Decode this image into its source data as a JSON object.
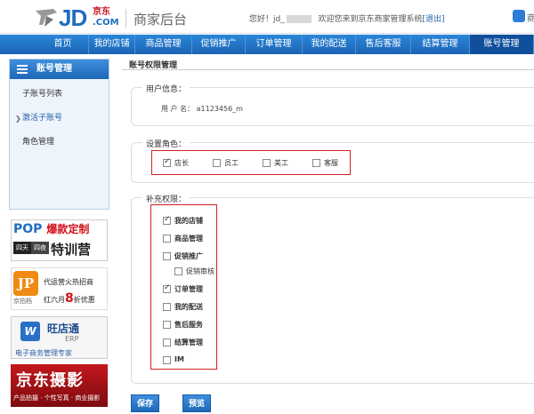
{
  "header": {
    "brand_cn": "京东",
    "brand_jd": "JD",
    "brand_com": ".COM",
    "title": "商家后台",
    "greeting": "您好！jd_",
    "welcome_text": "欢迎您来到京东商家管理系统",
    "logout_label": "[退出]",
    "message_label": "商"
  },
  "nav": {
    "items": [
      "首页",
      "我的店铺",
      "商品管理",
      "促销推广",
      "订单管理",
      "我的配送",
      "售后客服",
      "结算管理",
      "账号管理"
    ],
    "active": "账号管理"
  },
  "sidebar": {
    "title": "账号管理",
    "items": [
      {
        "label": "子账号列表",
        "active": false
      },
      {
        "label": "激活子账号",
        "active": true
      },
      {
        "label": "角色管理",
        "active": false
      }
    ]
  },
  "banners": {
    "b1_pop": "POP",
    "b1_red": "爆款定制",
    "b1_sq1": "四天",
    "b1_sq2": "四夜",
    "b1_big": "特训营",
    "b2_logo": "JP",
    "b2_sub": "京拍档",
    "b2_l1": "代运营火热招商",
    "b2_l2a": "红六月",
    "b2_l2b": "8",
    "b2_l2c": "折优惠",
    "b3_icon": "W",
    "b3_t1": "旺店通",
    "b3_t2": "ERP",
    "b3_t3": "电子商务管理专家",
    "b4_t1": "京东摄影",
    "b4_t2": "产品拍摄 · 个性写真 · 商业摄影"
  },
  "main": {
    "page_title": "账号权限管理",
    "user_info": {
      "legend": "用户信息：",
      "username_label": "用 户 名：",
      "username_value": "a1123456_m"
    },
    "roles": {
      "legend": "设置角色：",
      "items": [
        {
          "label": "店长",
          "checked": true
        },
        {
          "label": "员工",
          "checked": false
        },
        {
          "label": "美工",
          "checked": false
        },
        {
          "label": "客服",
          "checked": false
        }
      ]
    },
    "permissions": {
      "legend": "补充权限：",
      "items": [
        {
          "label": "我的店铺",
          "checked": true,
          "sub": false
        },
        {
          "label": "商品管理",
          "checked": false,
          "sub": false
        },
        {
          "label": "促销推广",
          "checked": false,
          "sub": false
        },
        {
          "label": "促销审核",
          "checked": false,
          "sub": true
        },
        {
          "label": "订单管理",
          "checked": true,
          "sub": false
        },
        {
          "label": "我的配送",
          "checked": false,
          "sub": false
        },
        {
          "label": "售后服务",
          "checked": false,
          "sub": false
        },
        {
          "label": "结算管理",
          "checked": false,
          "sub": false
        },
        {
          "label": "IM",
          "checked": false,
          "sub": false
        }
      ]
    },
    "buttons": {
      "save": "保存",
      "preview": "预览"
    }
  }
}
